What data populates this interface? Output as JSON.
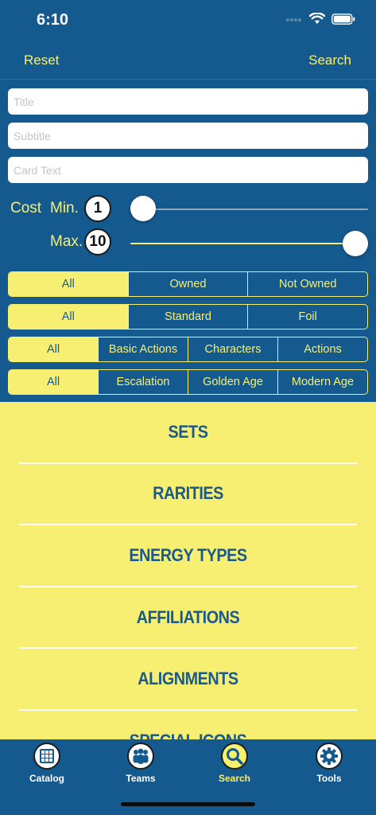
{
  "status_bar": {
    "time": "6:10"
  },
  "nav": {
    "reset_label": "Reset",
    "search_label": "Search"
  },
  "fields": {
    "title_placeholder": "Title",
    "subtitle_placeholder": "Subtitle",
    "card_text_placeholder": "Card Text"
  },
  "cost": {
    "label": "Cost",
    "min_label": "Min.",
    "max_label": "Max.",
    "min_value": "1",
    "max_value": "10",
    "slider_min_fraction": 0.0,
    "slider_max_fraction": 1.0
  },
  "segments": [
    {
      "items": [
        "All",
        "Owned",
        "Not Owned"
      ],
      "selected": 0
    },
    {
      "items": [
        "All",
        "Standard",
        "Foil"
      ],
      "selected": 0
    },
    {
      "items": [
        "All",
        "Basic Actions",
        "Characters",
        "Actions"
      ],
      "selected": 0
    },
    {
      "items": [
        "All",
        "Escalation",
        "Golden Age",
        "Modern Age"
      ],
      "selected": 0
    }
  ],
  "categories": [
    "SETS",
    "RARITIES",
    "ENERGY TYPES",
    "AFFILIATIONS",
    "ALIGNMENTS",
    "SPECIAL ICONS"
  ],
  "tabs": [
    {
      "label": "Catalog",
      "icon": "grid-icon",
      "active": false
    },
    {
      "label": "Teams",
      "icon": "people-icon",
      "active": false
    },
    {
      "label": "Search",
      "icon": "search-icon",
      "active": true
    },
    {
      "label": "Tools",
      "icon": "gear-icon",
      "active": false
    }
  ],
  "colors": {
    "background": "#155a8f",
    "accent": "#f7ef72",
    "accent_text": "#1a5a8c"
  }
}
